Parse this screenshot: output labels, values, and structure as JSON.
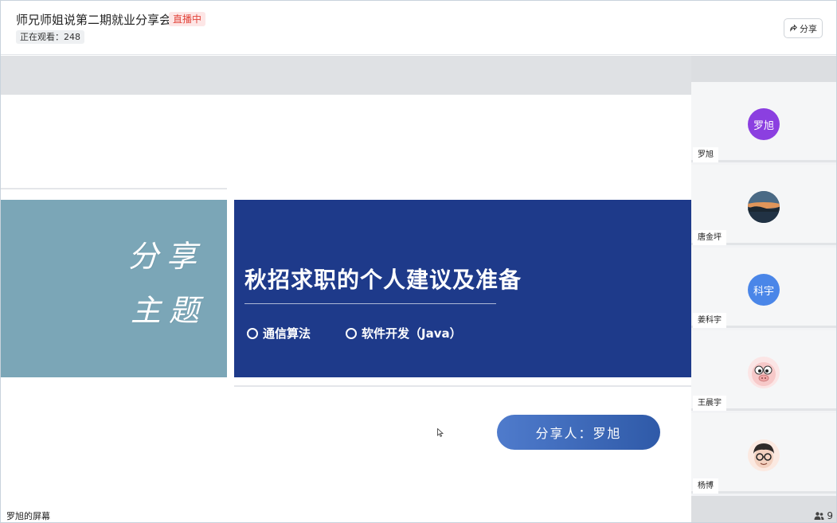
{
  "header": {
    "title": "师兄师姐说第二期就业分享会",
    "live_badge": "直播中",
    "viewers": "正在观看：248",
    "share_label": "分享"
  },
  "slide": {
    "calligraphy_line1": "分享",
    "calligraphy_line2": "主题",
    "title": "秋招求职的个人建议及准备",
    "options": [
      "通信算法",
      "软件开发（Java）"
    ],
    "presenter": "分享人：罗旭"
  },
  "screen_label": "罗旭的屏幕",
  "participants": [
    {
      "name": "罗旭",
      "avatar_text": "罗旭",
      "avatar_color": "#8b3fe0",
      "avatar_type": "text"
    },
    {
      "name": "唐金坪",
      "avatar_text": "",
      "avatar_color": "#2b3e52",
      "avatar_type": "landscape-photo-icon"
    },
    {
      "name": "姜科宇",
      "avatar_text": "科宇",
      "avatar_color": "#4a86e8",
      "avatar_type": "text"
    },
    {
      "name": "王晨宇",
      "avatar_text": "",
      "avatar_color": "#f7c9c9",
      "avatar_type": "cartoon-pig-icon"
    },
    {
      "name": "杨博",
      "avatar_text": "",
      "avatar_color": "#f3d1c0",
      "avatar_type": "cartoon-glasses-boy-icon"
    }
  ],
  "participant_count": "9",
  "colors": {
    "live_red": "#e2473d",
    "slide_blue": "#1e3a8a",
    "slide_teal": "#7ba6b7",
    "pill_blue": "#3f6bbd"
  }
}
